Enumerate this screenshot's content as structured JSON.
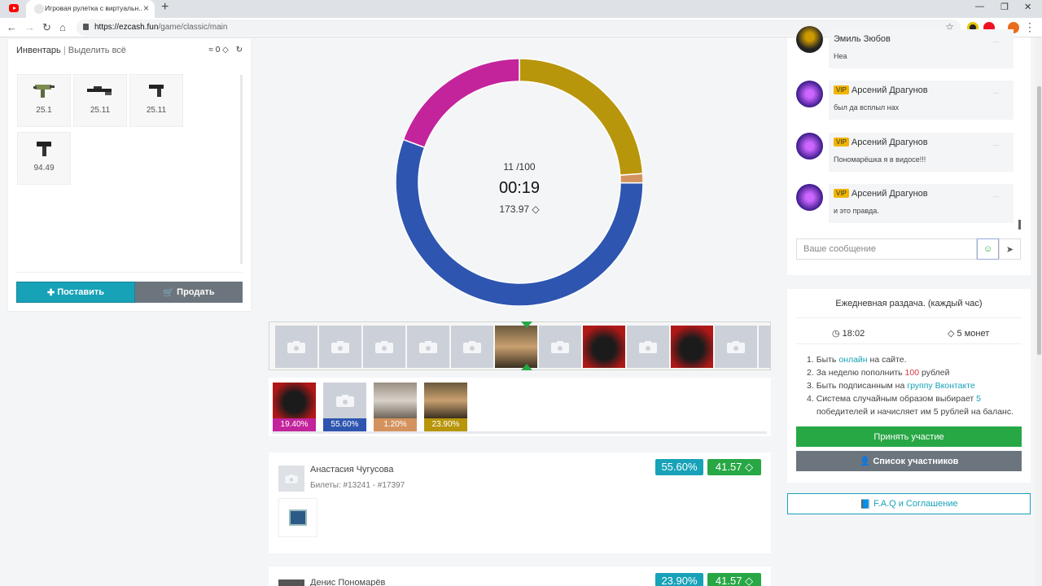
{
  "browser": {
    "tab_title": "Игровая рулетка с виртуальн...",
    "url_host": "https://ezcash.fun",
    "url_path": "/game/classic/main"
  },
  "inventory": {
    "title": "Инвентарь",
    "separator": "|",
    "select_all": "Выделить всё",
    "total": "≈ 0",
    "items": [
      {
        "price": "25.1",
        "icon": "smg-green-icon"
      },
      {
        "price": "25.11",
        "icon": "sniper-rifle-icon"
      },
      {
        "price": "25.11",
        "icon": "pistol-icon"
      },
      {
        "price": "94.49",
        "icon": "smg-black-icon"
      }
    ],
    "bet_label": "Поставить",
    "sell_label": "Продать"
  },
  "round": {
    "items_count": "11 /",
    "items_max": "100",
    "timer": "00:19",
    "bank": "173.97"
  },
  "chart_data": {
    "type": "pie",
    "values": [
      23.9,
      1.2,
      55.6,
      19.4
    ],
    "colors": [
      "#b8960c",
      "#d4935e",
      "#2e55b0",
      "#c3249c"
    ]
  },
  "chances": [
    {
      "pct": "19.40%",
      "color": "#c3249c"
    },
    {
      "pct": "55.60%",
      "color": "#2e55b0"
    },
    {
      "pct": "1.20%",
      "color": "#d4935e"
    },
    {
      "pct": "23.90%",
      "color": "#b8960c"
    }
  ],
  "bets": [
    {
      "name": "Анастасия Чугусова",
      "tickets": "Билеты: #13241 - #17397",
      "chance": "55.60%",
      "amount": "41.57"
    },
    {
      "name": "Денис Пономарёв",
      "chance": "23.90%",
      "amount": "41.57"
    }
  ],
  "chat": {
    "messages": [
      {
        "name": "Эмиль Зюбов",
        "vip": "",
        "text": "Неа"
      },
      {
        "name": "Арсений Драгунов",
        "vip": "VIP",
        "text": "был да всплыл нах"
      },
      {
        "name": "Арсений Драгунов",
        "vip": "VIP",
        "text": "Пономарёшка я в видосе!!!"
      },
      {
        "name": "Арсений Драгунов",
        "vip": "VIP",
        "text": "и это правда."
      }
    ],
    "dots": "...",
    "placeholder": "Ваше сообщение"
  },
  "daily": {
    "title": "Ежедневная раздача. (каждый час)",
    "time": "18:02",
    "reward": "5 монет",
    "rule1_a": "Быть ",
    "rule1_b": "онлайн",
    "rule1_c": " на сайте.",
    "rule2_a": "За неделю пополнить ",
    "rule2_b": "100",
    "rule2_c": " рублей",
    "rule3_a": "Быть подписанным на ",
    "rule3_b": "группу Вконтакте",
    "rule4_a": "Система случайным образом выбирает ",
    "rule4_b": "5",
    "rule4_c": " победителей и начисляет им 5 рублей на баланс.",
    "join_label": "Принять участие",
    "list_label": "Список участников"
  },
  "faq_label": "F.A.Q и Соглашение"
}
